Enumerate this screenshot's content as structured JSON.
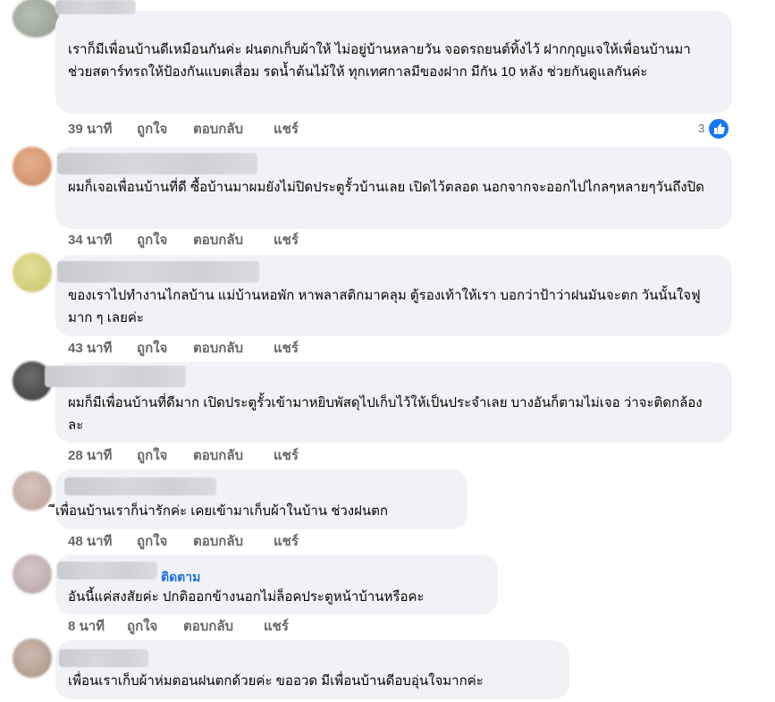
{
  "comments": [
    {
      "text": "เราก็มีเพื่อนบ้านดีเหมือนกันค่ะ ฝนตกเก็บผ้าให้ ไม่อยู่บ้านหลายวัน จอดรถยนต์ทิ้งไว้ ฝากกุญแจให้เพื่อนบ้านมาช่วยสตาร์ทรถให้ป้องกันแบตเสื่อม รดน้ำต้นไม้ให้ ทุกเทศกาลมีของฝาก มีกัน 10 หลัง ช่วยกันดูแลกันค่ะ",
      "time": "39 นาที",
      "reactions": "3"
    },
    {
      "text": "ผมก็เจอเพื่อนบ้านที่ดี ซื้อบ้านมาผมยังไม่ปิดประตูรั้วบ้านเลย เปิดไว้ตลอด นอกจากจะออกไปไกลๆหลายๆวันถึงปิด",
      "time": "34 นาที"
    },
    {
      "text": "ของเราไปทำงานไกลบ้าน แม่บ้านหอพัก หาพลาสติกมาคลุม ตู้รองเท้าให้เรา บอกว่าป้าว่าฝนมันจะตก วันนั้นใจฟูมาก ๆ เลยค่ะ",
      "time": "43 นาที"
    },
    {
      "text": "ผมก็มีเพื่อนบ้านที่ดีมาก เปิดประตูรั้วเข้ามาหยิบพัสดุไปเก็บไว้ให้เป็นประจำเลย บางอันก็ตามไม่เจอ ว่าจะติดกล้องละ",
      "time": "28 นาที"
    },
    {
      "text": "ีเพื่อนบ้านเราก็น่ารักค่ะ เคยเข้ามาเก็บผ้าในบ้าน ช่วงฝนตก",
      "time": "48 นาที"
    },
    {
      "follow": "ติดตาม",
      "text": "อันนี้แค่สงสัยค่ะ ปกติออกข้างนอกไม่ล็อคประตูหน้าบ้านหรือคะ",
      "time": "8 นาที"
    },
    {
      "text": "เพื่อนเราเก็บผ้าห่มตอนฝนตกด้วยค่ะ ขออวด มีเพื่อนบ้านดีอบอุ่นใจมากค่ะ"
    }
  ],
  "actions": {
    "like": "ถูกใจ",
    "reply": "ตอบกลับ",
    "share": "แชร์"
  },
  "colors": {
    "bubble": "#f0f2f5",
    "link": "#216fdb",
    "meta": "#65676b",
    "like_badge": "#1877f2"
  },
  "icons": {
    "reaction": "like-thumb-icon"
  }
}
